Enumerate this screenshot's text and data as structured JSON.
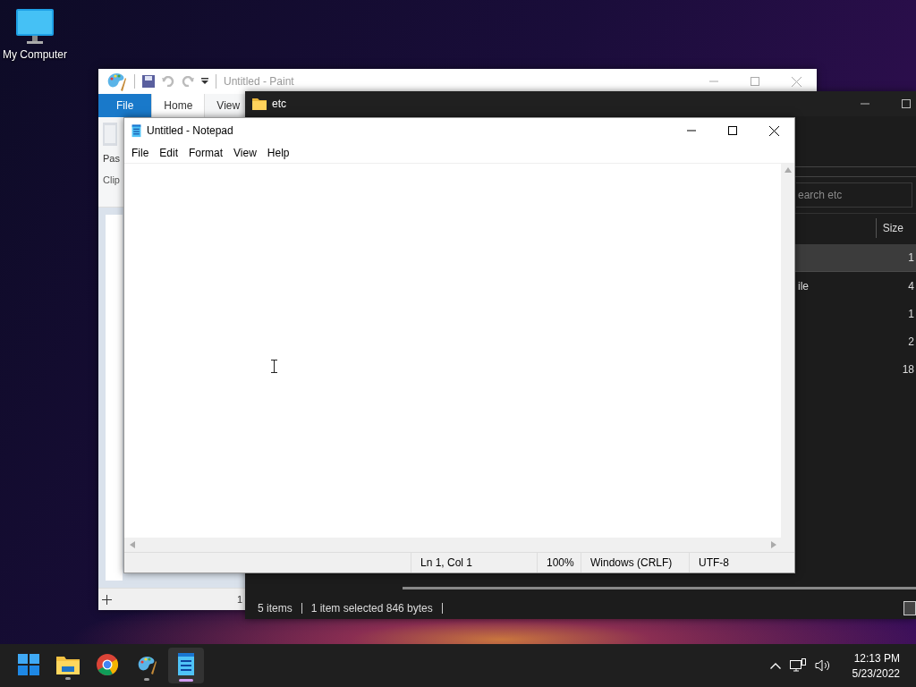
{
  "desktop_icons": [
    {
      "label": "My Computer"
    }
  ],
  "paint_window": {
    "title": "Untitled - Paint",
    "tabs": [
      {
        "label": "File",
        "kind": "file",
        "selected": false
      },
      {
        "label": "Home",
        "kind": "tab",
        "selected": true
      },
      {
        "label": "View",
        "kind": "tab",
        "selected": false
      }
    ],
    "ribbon_button": "Pas",
    "ribbon_group": "Clip",
    "status_text": "1"
  },
  "explorer_window": {
    "title": "etc",
    "search": {
      "placeholder": "earch etc"
    },
    "columns": [
      {
        "label": "Size"
      }
    ],
    "rows": [
      {
        "selected": true,
        "column_2": "",
        "size": "1"
      },
      {
        "selected": false,
        "column_2": "ile",
        "size": "4"
      },
      {
        "selected": false,
        "column_2": "",
        "size": "1"
      },
      {
        "selected": false,
        "column_2": "",
        "size": "2"
      },
      {
        "selected": false,
        "column_2": "",
        "size": "18"
      }
    ],
    "status_bar": [
      "5 items",
      "1 item selected  846 bytes"
    ]
  },
  "notepad_window": {
    "title": "Untitled - Notepad",
    "menu": [
      "File",
      "Edit",
      "Format",
      "View",
      "Help"
    ],
    "status_bar": [
      "Ln 1, Col 1",
      "100%",
      "Windows (CRLF)",
      "UTF-8"
    ]
  },
  "taskbar": {
    "apps": [
      {
        "kind": "start",
        "running": false,
        "selected": false
      },
      {
        "kind": "explorer",
        "running": true,
        "selected": false
      },
      {
        "kind": "chrome",
        "running": false,
        "selected": false
      },
      {
        "kind": "paint",
        "running": true,
        "selected": false
      },
      {
        "kind": "notepad",
        "running": true,
        "selected": true
      }
    ],
    "time": "12:13 PM",
    "date": "5/23/2022"
  }
}
